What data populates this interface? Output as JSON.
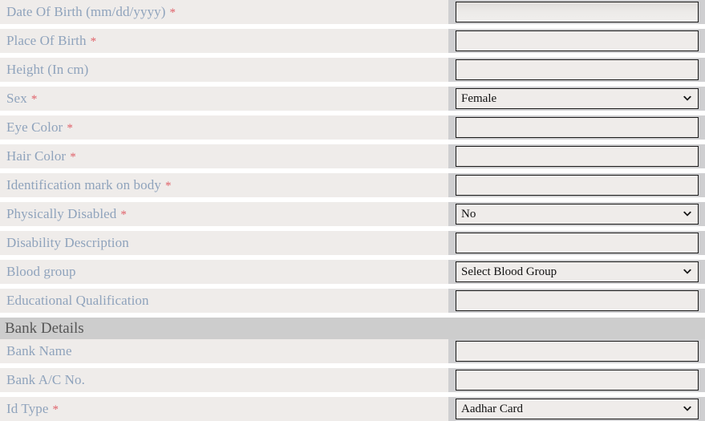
{
  "form": {
    "required_marker": "*",
    "chevron_icon": "chevron-down-icon",
    "label_color": "#8fa3bc",
    "required_color": "#e0636b",
    "section_text_color": "#565656",
    "row_bg": "#efecea",
    "gap_bg": "#cfcfd1",
    "input_border_color": "#1a1a1a",
    "rows": [
      {
        "label": "Date Of Birth (mm/dd/yyyy)",
        "required": true,
        "type": "text",
        "value": "",
        "name": "date-of-birth"
      },
      {
        "label": "Place Of Birth",
        "required": true,
        "type": "text",
        "value": "",
        "name": "place-of-birth"
      },
      {
        "label": "Height (In cm)",
        "required": false,
        "type": "text",
        "value": "",
        "name": "height"
      },
      {
        "label": "Sex",
        "required": true,
        "type": "select",
        "value": "Female",
        "name": "sex"
      },
      {
        "label": "Eye Color",
        "required": true,
        "type": "text",
        "value": "",
        "name": "eye-color"
      },
      {
        "label": "Hair Color",
        "required": true,
        "type": "text",
        "value": "",
        "name": "hair-color"
      },
      {
        "label": "Identification mark on body",
        "required": true,
        "type": "text",
        "value": "",
        "name": "identification-mark"
      },
      {
        "label": "Physically Disabled",
        "required": true,
        "type": "select",
        "value": "No",
        "name": "physically-disabled"
      },
      {
        "label": "Disability Description",
        "required": false,
        "type": "text",
        "value": "",
        "name": "disability-description"
      },
      {
        "label": "Blood group",
        "required": false,
        "type": "select",
        "value": "Select Blood Group",
        "name": "blood-group"
      },
      {
        "label": "Educational Qualification",
        "required": false,
        "type": "text",
        "value": "",
        "name": "educational-qualification"
      },
      {
        "label": "Bank Details",
        "required": false,
        "type": "section",
        "value": "",
        "name": "bank-details"
      },
      {
        "label": "Bank Name",
        "required": false,
        "type": "text",
        "value": "",
        "name": "bank-name"
      },
      {
        "label": "Bank A/C No.",
        "required": false,
        "type": "text",
        "value": "",
        "name": "bank-account-number"
      },
      {
        "label": "Id Type",
        "required": true,
        "type": "select",
        "value": "Aadhar Card",
        "name": "id-type"
      }
    ]
  }
}
